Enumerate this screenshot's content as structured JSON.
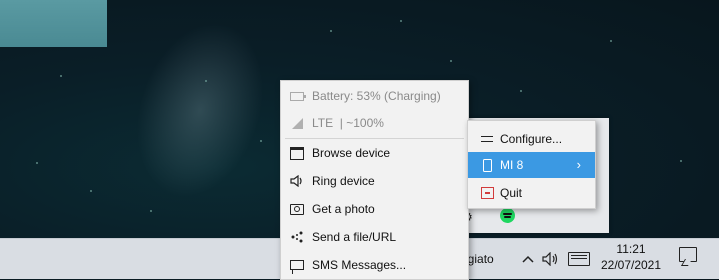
{
  "taskbar": {
    "app_text": "ggiato",
    "time": "11:21",
    "date": "22/07/2021",
    "icons": [
      "chevron-up-icon",
      "volume-icon",
      "keyboard-icon",
      "notification-icon"
    ]
  },
  "tray": {
    "icons": [
      "settings-icon",
      "spotify-icon"
    ],
    "colors": {
      "spotify": "#1ed760"
    }
  },
  "menu": {
    "items": [
      {
        "label": "Battery: 53% (Charging)",
        "icon": "battery-icon",
        "enabled": false
      },
      {
        "label": "LTE  | ~100%",
        "icon": "signal-icon",
        "enabled": false
      },
      {
        "label": "Browse device",
        "icon": "folder-icon",
        "enabled": true
      },
      {
        "label": "Ring device",
        "icon": "speaker-icon",
        "enabled": true
      },
      {
        "label": "Get a photo",
        "icon": "camera-icon",
        "enabled": true
      },
      {
        "label": "Send a file/URL",
        "icon": "share-icon",
        "enabled": true
      },
      {
        "label": "SMS Messages...",
        "icon": "chat-icon",
        "enabled": true
      }
    ]
  },
  "submenu": {
    "items": [
      {
        "label": "Configure...",
        "icon": "sliders-icon"
      },
      {
        "label": "MI 8",
        "icon": "phone-icon",
        "selected": true,
        "arrow": "›"
      },
      {
        "label": "Quit",
        "icon": "quit-icon"
      }
    ],
    "colors": {
      "selected_bg": "#3b99e3",
      "quit": "#d23b3b"
    }
  }
}
